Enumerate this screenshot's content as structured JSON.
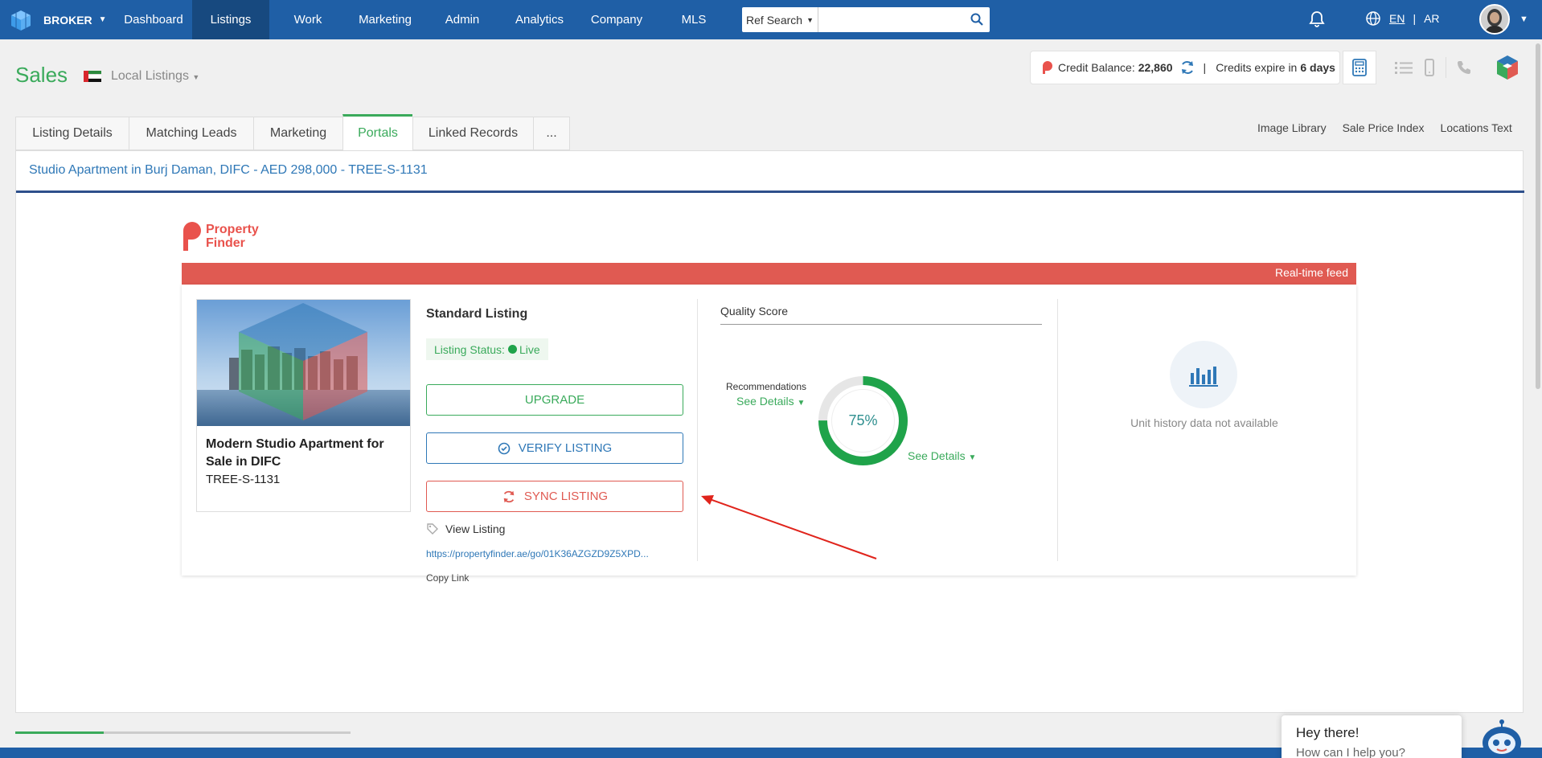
{
  "nav": {
    "brand": "BROKER",
    "items": [
      "Dashboard",
      "Listings",
      "Work",
      "Marketing",
      "Admin",
      "Analytics",
      "Company",
      "MLS"
    ],
    "active": "Listings",
    "ref_search_label": "Ref Search",
    "search_value": "",
    "lang_en": "EN",
    "lang_sep": "|",
    "lang_ar": "AR"
  },
  "header": {
    "title": "Sales",
    "listing_scope": "Local Listings"
  },
  "credit": {
    "label": "Credit Balance:",
    "value": "22,860",
    "sep": "|",
    "expire_label": "Credits expire in",
    "expire_value": "6 days"
  },
  "tabs": [
    "Listing Details",
    "Matching Leads",
    "Marketing",
    "Portals",
    "Linked Records",
    "..."
  ],
  "active_tab": "Portals",
  "right_links": [
    "Image Library",
    "Sale Price Index",
    "Locations Text"
  ],
  "panel": {
    "title": "Studio Apartment in Burj Daman, DIFC - AED 298,000 - TREE-S-1131"
  },
  "portal": {
    "logo_line1": "Property",
    "logo_line2": "Finder",
    "feed_label": "Real-time feed",
    "listing_name": "Modern Studio Apartment for Sale in DIFC",
    "listing_ref": "TREE-S-1131",
    "listing_type": "Standard Listing",
    "status_label": "Listing Status:",
    "status_value": "Live",
    "upgrade": "UPGRADE",
    "verify": "VERIFY LISTING",
    "sync": "SYNC LISTING",
    "view_listing": "View Listing",
    "url": "https://propertyfinder.ae/go/01K36AZGZD9Z5XPD...",
    "copy_link": "Copy Link",
    "quality_title": "Quality Score",
    "recommendations": "Recommendations",
    "see_details": "See Details",
    "quality_percent": "75%",
    "quality_value": 75,
    "unit_history": "Unit history data not available"
  },
  "chat": {
    "greeting": "Hey there!",
    "prompt": "How can I help you?"
  },
  "colors": {
    "nav": "#1f5fa6",
    "green": "#3aaa5b",
    "red": "#e05a52",
    "blue": "#2f78b7"
  }
}
